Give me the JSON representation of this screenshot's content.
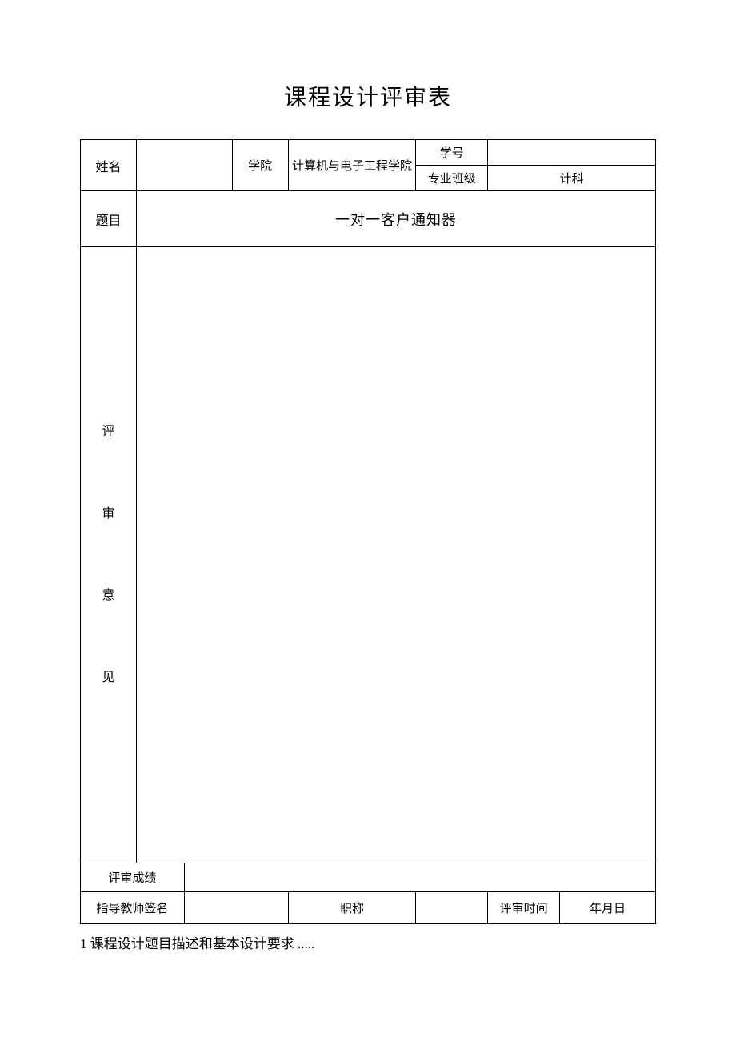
{
  "title": "课程设计评审表",
  "labels": {
    "name": "姓名",
    "college": "学院",
    "studentId": "学号",
    "majorClass": "专业班级",
    "topic": "题目",
    "reviewOpinion": "评\n\n审\n\n意\n\n见",
    "reviewScore": "评审成绩",
    "supervisorSign": "指导教师签名",
    "jobTitle": "职称",
    "reviewTime": "评审时间",
    "dateFmt": "年月日"
  },
  "values": {
    "name": "",
    "college": "计算机与电子工程学院",
    "studentId": "",
    "majorClass": "计科",
    "topic": "一对一客户通知器",
    "reviewOpinion": "",
    "reviewScore": "",
    "supervisorSign": "",
    "jobTitle": "",
    "reviewTime": ""
  },
  "footer": "1 课程设计题目描述和基本设计要求 ....."
}
